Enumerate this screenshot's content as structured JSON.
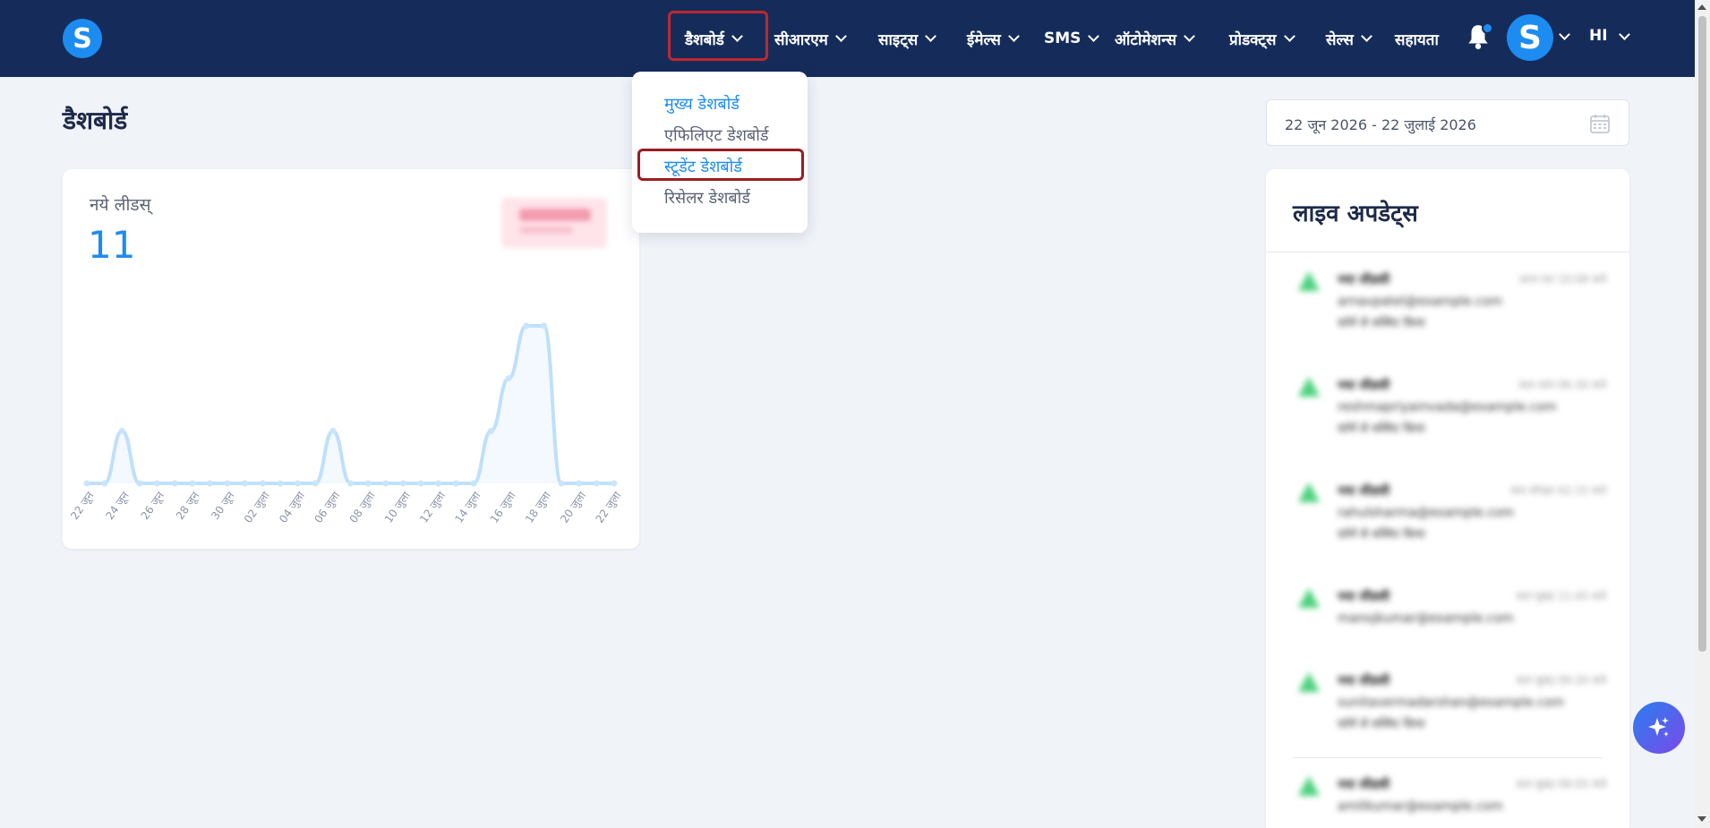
{
  "app": {
    "logo_letter": "S"
  },
  "nav": {
    "items": [
      {
        "label": "डैशबोर्ड"
      },
      {
        "label": "सीआरएम"
      },
      {
        "label": "साइट्स"
      },
      {
        "label": "ईमेल्स"
      },
      {
        "label": "SMS"
      },
      {
        "label": "ऑटोमेशन्स"
      },
      {
        "label": "प्रोडक्ट्स"
      },
      {
        "label": "सेल्स"
      },
      {
        "label": "सहायता"
      }
    ],
    "avatar_letter": "S",
    "language": "HI"
  },
  "dropdown": {
    "items": [
      {
        "label": "मुख्य डेशबोर्ड"
      },
      {
        "label": "एफिलिएट डेशबोर्ड"
      },
      {
        "label": "स्टूडेंट डेशबोर्ड"
      },
      {
        "label": "रिसेलर डेशबोर्ड"
      }
    ]
  },
  "page": {
    "title": "डैशबोर्ड"
  },
  "date_range": {
    "value": "22 जून 2026 - 22 जुलाई 2026"
  },
  "leads_card": {
    "label": "नये लीडस्",
    "value": "11"
  },
  "chart_data": {
    "type": "area",
    "x": [
      "22 जून",
      "23 जून",
      "24 जून",
      "25 जून",
      "26 जून",
      "27 जून",
      "28 जून",
      "29 जून",
      "30 जून",
      "01 जुला",
      "02 जुला",
      "03 जुला",
      "04 जुला",
      "05 जुला",
      "06 जुला",
      "07 जुला",
      "08 जुला",
      "09 जुला",
      "10 जुला",
      "11 जुला",
      "12 जुला",
      "13 जुला",
      "14 जुला",
      "15 जुला",
      "16 जुला",
      "17 जुला",
      "18 जुला",
      "19 जुला",
      "20 जुला",
      "21 जुला",
      "22 जुला"
    ],
    "values": [
      0,
      0,
      1,
      0,
      0,
      0,
      0,
      0,
      0,
      0,
      0,
      0,
      0,
      0,
      1,
      0,
      0,
      0,
      0,
      0,
      0,
      0,
      0,
      1,
      2,
      3,
      3,
      0,
      0,
      0,
      0
    ],
    "tick_labels": [
      "22 जून",
      "24 जून",
      "26 जून",
      "28 जून",
      "30 जून",
      "02 जुला",
      "04 जुला",
      "06 जुला",
      "08 जुला",
      "10 जुला",
      "12 जुला",
      "14 जुला",
      "16 जुला",
      "18 जुला",
      "20 जुला",
      "22 जुला"
    ],
    "ylim": [
      0,
      3
    ],
    "color": "#1d8cf0"
  },
  "live_updates": {
    "title": "लाइव अपडेट्स",
    "items": [
      {
        "name": "नया लीडसी",
        "time": "आज रात 10:08 बजे",
        "email": "arnavpatel@example.com",
        "source": "फ़ॉर्म से सब्मिट किया"
      },
      {
        "name": "नया लीडसी",
        "time": "कल शाम 06:30 बजे",
        "email": "reshmapriyamvada@example.com",
        "source": "फ़ॉर्म से सब्मिट किया"
      },
      {
        "name": "नया लीडसी",
        "time": "कल दोपहर 02:15 बजे",
        "email": "rahulsharma@example.com",
        "source": "फ़ॉर्म से सब्मिट किया"
      },
      {
        "name": "नया लीडसी",
        "time": "कल सुबह 11:45 बजे",
        "email": "manojkumar@example.com",
        "source": ""
      },
      {
        "name": "नया लीडसी",
        "time": "कल सुबह 09:20 बजे",
        "email": "sunitavermadarshan@example.com",
        "source": "फ़ॉर्म से सब्मिट किया"
      },
      {
        "name": "नया लीडसी",
        "time": "कल सुबह 08:05 बजे",
        "email": "amitkumar@example.com",
        "source": ""
      }
    ]
  }
}
